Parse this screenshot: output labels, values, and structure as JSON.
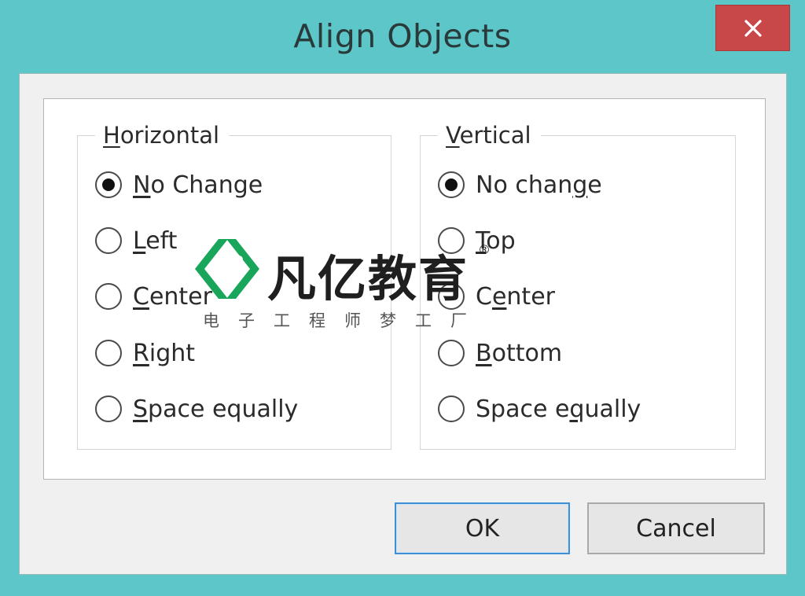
{
  "window": {
    "title": "Align Objects"
  },
  "horizontal": {
    "label": "Horizontal",
    "options": [
      {
        "pre": "",
        "key": "N",
        "post": "o Change"
      },
      {
        "pre": "",
        "key": "L",
        "post": "eft"
      },
      {
        "pre": "",
        "key": "C",
        "post": "enter"
      },
      {
        "pre": "",
        "key": "R",
        "post": "ight"
      },
      {
        "pre": "",
        "key": "S",
        "post": "pace equally"
      }
    ],
    "selected": 0
  },
  "vertical": {
    "label": "Vertical",
    "options": [
      {
        "pre": "No chan",
        "key": "g",
        "post": "e"
      },
      {
        "pre": "",
        "key": "T",
        "post": "op"
      },
      {
        "pre": "C",
        "key": "e",
        "post": "nter"
      },
      {
        "pre": "",
        "key": "B",
        "post": "ottom"
      },
      {
        "pre": "Space e",
        "key": "q",
        "post": "ually"
      }
    ],
    "selected": 0
  },
  "buttons": {
    "ok": "OK",
    "cancel": "Cancel"
  },
  "watermark": {
    "brand": "凡亿教育",
    "registered": "®",
    "subtitle": "电子工程师梦工厂"
  },
  "colors": {
    "window_frame": "#5cc6c8",
    "close_button": "#c8484a",
    "ok_focus_border": "#3f8fd6",
    "watermark_green": "#1aa65a"
  },
  "icons": {
    "close": "close-icon",
    "logo": "brand-logo-icon"
  }
}
